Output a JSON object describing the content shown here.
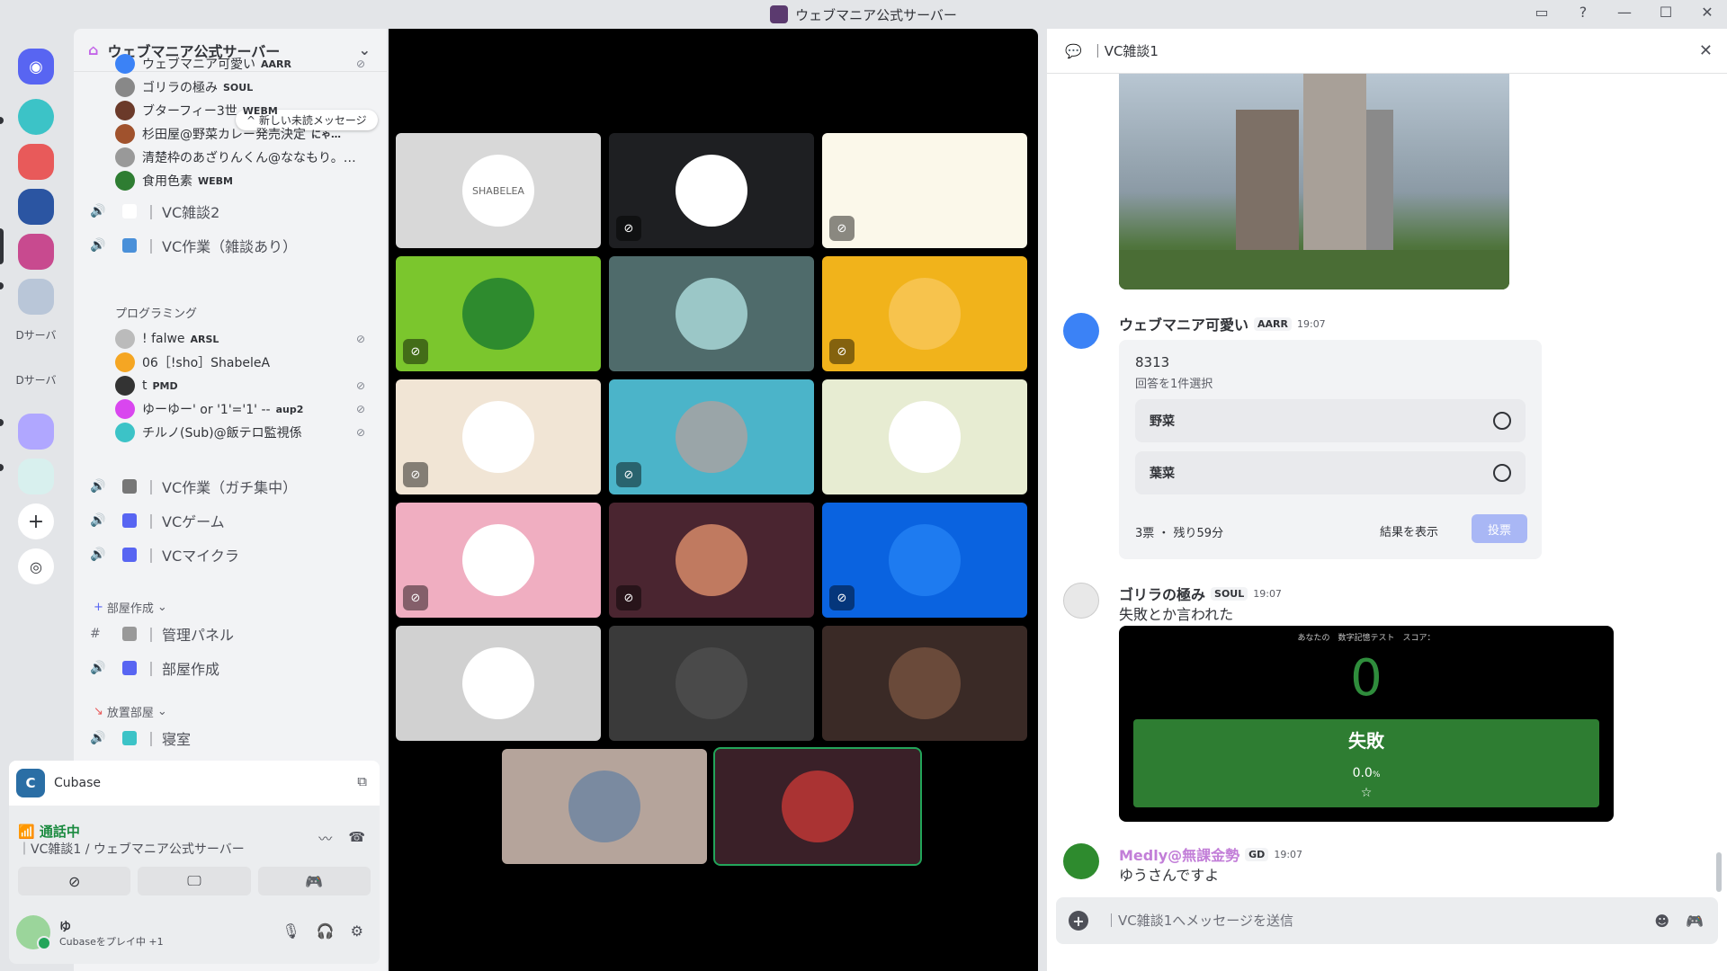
{
  "window": {
    "title": "ウェブマニア公式サーバー",
    "icons": [
      "inbox-icon",
      "help-icon",
      "minimize-icon",
      "maximize-icon",
      "close-icon"
    ]
  },
  "rail": {
    "labels": [
      "Dサーバ",
      "Dサーバ"
    ],
    "colors": [
      "#5865f2",
      "#3cc3c7",
      "#d44",
      "#2b55a2",
      "#c84a8f",
      "#7fb3e0",
      "#b0a7ff",
      "#d8f0ee"
    ]
  },
  "server": {
    "name": "ウェブマニア公式サーバー"
  },
  "sidebar": {
    "new_message_pill": "新しい未読メッセージ",
    "members_top": [
      {
        "name": "ウェブマニア可愛い",
        "tag": "AARR",
        "color": "#3b82f6",
        "muted": true
      },
      {
        "name": "ゴリラの極み",
        "tag": "SOUL",
        "color": "#888",
        "muted": false
      },
      {
        "name": "ブターフィー3世",
        "tag": "WEBM",
        "color": "#6b3a2a",
        "muted": false
      },
      {
        "name": "杉田屋@野菜カレー発売決定",
        "tag": "にゃ…",
        "color": "#a0522d",
        "muted": false
      },
      {
        "name": "清楚枠のあざりんくん@ななもり。…",
        "tag": "",
        "color": "#999",
        "muted": false
      },
      {
        "name": "食用色素",
        "tag": "WEBM",
        "color": "#2e7d32",
        "muted": false
      }
    ],
    "channels_a": [
      {
        "name": "VC雑談2",
        "icon_color": "#ffffff"
      },
      {
        "name": "VC作業（雑談あり）",
        "icon_color": "#4a90d9"
      }
    ],
    "subcategory": "プログラミング",
    "members_b": [
      {
        "name": "! falwe",
        "tag": "ARSL",
        "color": "#bbb",
        "muted": true
      },
      {
        "name": "06［!sho］ShabeleA",
        "tag": "",
        "color": "#f5a623",
        "muted": false
      },
      {
        "name": "t",
        "tag": "PMD",
        "color": "#333",
        "muted": true
      },
      {
        "name": "ゆーゆー' or '1'='1' --",
        "tag": "aup2",
        "color": "#d946ef",
        "muted": true
      },
      {
        "name": "チルノ(Sub)@飯テロ監視係",
        "tag": "",
        "color": "#3cc3c7",
        "muted": true
      }
    ],
    "channels_b": [
      {
        "name": "VC作業（ガチ集中）",
        "icon_color": "#777"
      },
      {
        "name": "VCゲーム",
        "icon_color": "#5865f2"
      },
      {
        "name": "VCマイクラ",
        "icon_color": "#5865f2"
      }
    ],
    "cat_room_create": "部屋作成",
    "channels_c": [
      {
        "name": "管理パネル",
        "hash": true,
        "icon_color": "#999"
      },
      {
        "name": "部屋作成",
        "hash": false,
        "icon_color": "#5865f2"
      }
    ],
    "cat_idle": "放置部屋",
    "channels_d": [
      {
        "name": "寝室",
        "icon_color": "#3cc3c7"
      }
    ]
  },
  "activity": {
    "name": "Cubase"
  },
  "voice": {
    "status": "通話中",
    "location": "｜VC雑談1 / ウェブマニア公式サーバー"
  },
  "user": {
    "name": "ゆ",
    "status": "Cubaseをプレイ中 +1"
  },
  "stage": {
    "tiles": [
      {
        "bg": "#d8d8d8",
        "av": "#ffffff",
        "label": "SHABELEA",
        "muted": false
      },
      {
        "bg": "#1e1f22",
        "av": "#ffffff",
        "label": "",
        "muted": true
      },
      {
        "bg": "#fbf8ea",
        "av": "#fbf8ea",
        "label": "",
        "muted": true
      },
      {
        "bg": "#7bc62d",
        "av": "#2e8b2e",
        "label": "",
        "muted": true
      },
      {
        "bg": "#4f6b6b",
        "av": "#9bc7c7",
        "label": "",
        "muted": false
      },
      {
        "bg": "#f1b31b",
        "av": "#f7c34d",
        "label": "",
        "muted": true
      },
      {
        "bg": "#f1e5d5",
        "av": "#ffffff",
        "label": "",
        "muted": true
      },
      {
        "bg": "#4bb4c9",
        "av": "#9aa5a8",
        "label": "",
        "muted": true
      },
      {
        "bg": "#e7ecd2",
        "av": "#ffffff",
        "label": "",
        "muted": false
      },
      {
        "bg": "#f0aec1",
        "av": "#ffffff",
        "label": "",
        "muted": true
      },
      {
        "bg": "#4a2530",
        "av": "#c07a60",
        "label": "",
        "muted": true
      },
      {
        "bg": "#0a63e0",
        "av": "#1e7bf0",
        "label": "",
        "muted": true
      },
      {
        "bg": "#d1d1d1",
        "av": "#ffffff",
        "label": "",
        "muted": false
      },
      {
        "bg": "#3a3a3a",
        "av": "#4a4a4a",
        "label": "",
        "muted": false
      },
      {
        "bg": "#3a2a26",
        "av": "#6a4a3a",
        "label": "",
        "muted": false
      },
      {
        "bg": "#b5a49b",
        "av": "#7a8aa0",
        "label": "",
        "muted": false
      },
      {
        "bg": "#3a2028",
        "av": "#a33",
        "label": "",
        "muted": false
      }
    ]
  },
  "chat": {
    "title": "｜VC雑談1",
    "poll_msg": {
      "name": "ウェブマニア可愛い",
      "tag": "AARR",
      "time": "19:07",
      "av": "#3b82f6"
    },
    "poll": {
      "question": "8313",
      "hint": "回答を1件選択",
      "options": [
        "野菜",
        "葉菜"
      ],
      "votes": "3票 ・ 残り59分",
      "show_results": "結果を表示",
      "vote": "投票"
    },
    "msg2": {
      "name": "ゴリラの極み",
      "tag": "SOUL",
      "time": "19:07",
      "text": "失敗とか言われた",
      "av": "#cccccc"
    },
    "game": {
      "label": "あなたの　数字記憶テスト　スコア：",
      "score": "0",
      "fail": "失敗",
      "pct": "0.0",
      "star": "☆"
    },
    "msg3": {
      "name": "Medly@無課金勢",
      "tag": "GD",
      "time": "19:07",
      "text": "ゆうさんですよ",
      "av": "#2e8b2e"
    },
    "composer_placeholder": "｜VC雑談1へメッセージを送信"
  }
}
